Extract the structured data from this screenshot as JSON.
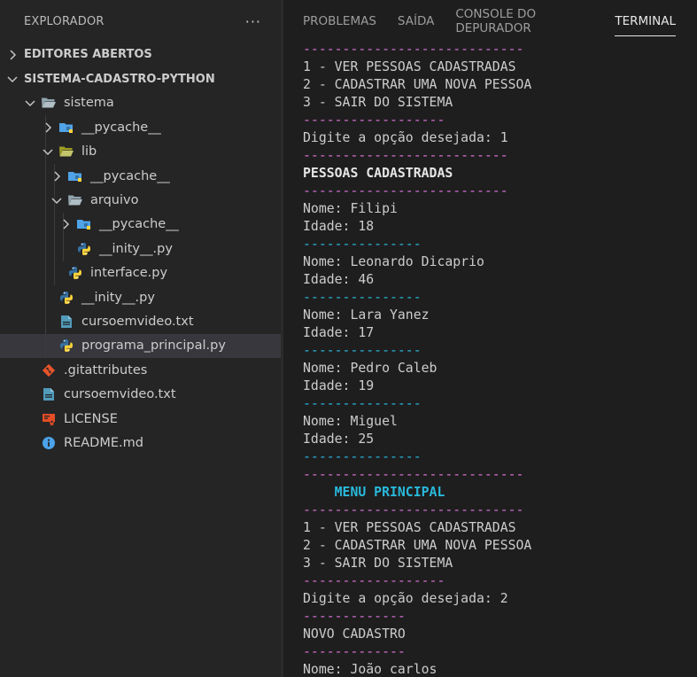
{
  "explorer": {
    "title": "EXPLORADOR",
    "more_actions": "···",
    "items": [
      {
        "label": "EDITORES ABERTOS",
        "type": "section",
        "chevron": "right",
        "depth": 0,
        "icon": "none"
      },
      {
        "label": "SISTEMA-CADASTRO-PYTHON",
        "type": "section",
        "chevron": "down",
        "depth": 0,
        "icon": "none"
      },
      {
        "label": "sistema",
        "type": "folder",
        "chevron": "down",
        "depth": 1,
        "icon": "folder-open-icon"
      },
      {
        "label": "__pycache__",
        "type": "folder",
        "chevron": "right",
        "depth": 2,
        "icon": "folder-pycache-icon"
      },
      {
        "label": "lib",
        "type": "folder",
        "chevron": "down",
        "depth": 2,
        "icon": "folder-lib-open-icon"
      },
      {
        "label": "__pycache__",
        "type": "folder",
        "chevron": "right",
        "depth": 3,
        "icon": "folder-pycache-icon"
      },
      {
        "label": "arquivo",
        "type": "folder",
        "chevron": "down",
        "depth": 3,
        "icon": "folder-open-icon"
      },
      {
        "label": "__pycache__",
        "type": "folder",
        "chevron": "right",
        "depth": 4,
        "icon": "folder-pycache-icon"
      },
      {
        "label": "__inity__.py",
        "type": "file",
        "chevron": "none",
        "depth": 4,
        "icon": "python-icon"
      },
      {
        "label": "interface.py",
        "type": "file",
        "chevron": "none",
        "depth": 3,
        "icon": "python-icon"
      },
      {
        "label": "__inity__.py",
        "type": "file",
        "chevron": "none",
        "depth": 2,
        "icon": "python-icon"
      },
      {
        "label": "cursoemvideo.txt",
        "type": "file",
        "chevron": "none",
        "depth": 2,
        "icon": "text-file-icon"
      },
      {
        "label": "programa_principal.py",
        "type": "file",
        "chevron": "none",
        "depth": 2,
        "icon": "python-icon",
        "selected": true
      },
      {
        "label": ".gitattributes",
        "type": "file",
        "chevron": "none",
        "depth": 1,
        "icon": "git-icon"
      },
      {
        "label": "cursoemvideo.txt",
        "type": "file",
        "chevron": "none",
        "depth": 1,
        "icon": "text-file-icon"
      },
      {
        "label": "LICENSE",
        "type": "file",
        "chevron": "none",
        "depth": 1,
        "icon": "license-icon"
      },
      {
        "label": "README.md",
        "type": "file",
        "chevron": "none",
        "depth": 1,
        "icon": "info-icon"
      }
    ]
  },
  "panel": {
    "tabs": [
      {
        "label": "PROBLEMAS",
        "active": false
      },
      {
        "label": "SAÍDA",
        "active": false
      },
      {
        "label": "CONSOLE DO DEPURADOR",
        "active": false
      },
      {
        "label": "TERMINAL",
        "active": true
      }
    ]
  },
  "terminal": {
    "lines": [
      {
        "text": "----------------------------",
        "style": "mag"
      },
      {
        "text": "1 - VER PESSOAS CADASTRADAS",
        "style": ""
      },
      {
        "text": "2 - CADASTRAR UMA NOVA PESSOA",
        "style": ""
      },
      {
        "text": "3 - SAIR DO SISTEMA",
        "style": ""
      },
      {
        "text": "------------------",
        "style": "mag"
      },
      {
        "text": "Digite a opção desejada: 1",
        "style": ""
      },
      {
        "text": "--------------------------",
        "style": "mag"
      },
      {
        "text": "PESSOAS CADASTRADAS",
        "style": "bold"
      },
      {
        "text": "--------------------------",
        "style": "mag"
      },
      {
        "text": "Nome: Filipi",
        "style": ""
      },
      {
        "text": "Idade: 18",
        "style": ""
      },
      {
        "text": "---------------",
        "style": "cyan"
      },
      {
        "text": "Nome: Leonardo Dicaprio",
        "style": ""
      },
      {
        "text": "Idade: 46",
        "style": ""
      },
      {
        "text": "---------------",
        "style": "cyan"
      },
      {
        "text": "Nome: Lara Yanez",
        "style": ""
      },
      {
        "text": "Idade: 17",
        "style": ""
      },
      {
        "text": "---------------",
        "style": "cyan"
      },
      {
        "text": "Nome: Pedro Caleb",
        "style": ""
      },
      {
        "text": "Idade: 19",
        "style": ""
      },
      {
        "text": "---------------",
        "style": "cyan"
      },
      {
        "text": "Nome: Miguel",
        "style": ""
      },
      {
        "text": "Idade: 25",
        "style": ""
      },
      {
        "text": "---------------",
        "style": "cyan"
      },
      {
        "text": "----------------------------",
        "style": "mag"
      },
      {
        "text": "    MENU PRINCIPAL",
        "style": "cyanbold"
      },
      {
        "text": "----------------------------",
        "style": "mag"
      },
      {
        "text": "1 - VER PESSOAS CADASTRADAS",
        "style": ""
      },
      {
        "text": "2 - CADASTRAR UMA NOVA PESSOA",
        "style": ""
      },
      {
        "text": "3 - SAIR DO SISTEMA",
        "style": ""
      },
      {
        "text": "------------------",
        "style": "mag"
      },
      {
        "text": "Digite a opção desejada: 2",
        "style": ""
      },
      {
        "text": "-------------",
        "style": "mag"
      },
      {
        "text": "NOVO CADASTRO",
        "style": ""
      },
      {
        "text": "-------------",
        "style": "mag"
      },
      {
        "text": "Nome: João carlos",
        "style": ""
      }
    ]
  },
  "colors": {
    "sidebar_bg": "#252526",
    "editor_bg": "#1e1e1e",
    "selected_row": "#37373d",
    "magenta": "#d670d6",
    "cyan": "#29b8db",
    "python_blue": "#3572A5",
    "python_yellow": "#ffd43b",
    "folder_blue": "#4fa3e6",
    "lib_yellow": "#c5c56d",
    "text_file_blue": "#519aba",
    "git_orange": "#e8542b",
    "license_red": "#e44d26",
    "info_blue": "#4aa3ea"
  }
}
